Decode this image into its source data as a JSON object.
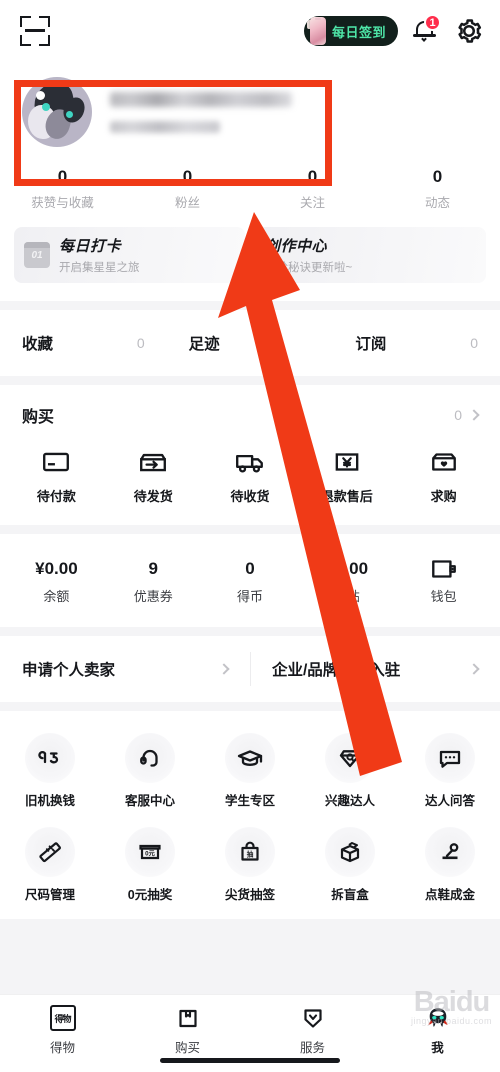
{
  "topbar": {
    "scan_icon": "scan-code-icon",
    "signin_label": "每日签到",
    "signin_bg": "#12201c",
    "signin_text_color": "#4ee6a8",
    "bell_icon": "bell-icon",
    "bell_badge": "1",
    "badge_color": "#ff2d4b",
    "gear_icon": "gear-icon"
  },
  "profile": {
    "avatar_icon": "user-avatar",
    "name_redacted": "",
    "id_redacted": "",
    "stats": [
      {
        "num": "0",
        "label": "获赞与收藏"
      },
      {
        "num": "0",
        "label": "粉丝"
      },
      {
        "num": "0",
        "label": "关注"
      },
      {
        "num": "0",
        "label": "动态"
      }
    ]
  },
  "promos": [
    {
      "title": "每日打卡",
      "subtitle": "开启集星星之旅",
      "icon": "calendar-icon",
      "icon_day": "01"
    },
    {
      "title": "创作中心",
      "subtitle": "进阶秘诀更新啦~",
      "icon": ""
    }
  ],
  "collect_row": [
    {
      "name": "收藏",
      "count": "0"
    },
    {
      "name": "足迹",
      "count": ""
    },
    {
      "name": "订阅",
      "count": "0"
    }
  ],
  "purchase": {
    "title": "购买",
    "count": "0",
    "chevron": "chevron-right-icon",
    "orders": [
      {
        "label": "待付款",
        "icon": "credit-card-icon"
      },
      {
        "label": "待发货",
        "icon": "package-shipping-icon"
      },
      {
        "label": "待收货",
        "icon": "truck-icon"
      },
      {
        "label": "退款售后",
        "icon": "refund-yen-icon"
      },
      {
        "label": "求购",
        "icon": "bag-heart-icon"
      }
    ]
  },
  "wallet": [
    {
      "value": "¥0.00",
      "label": "余额"
    },
    {
      "value": "9",
      "label": "优惠券"
    },
    {
      "value": "0",
      "label": "得币"
    },
    {
      "value": "¥0.00",
      "label": "津贴"
    },
    {
      "value": "",
      "label": "钱包",
      "icon": "wallet-icon"
    }
  ],
  "seller": [
    {
      "label": "申请个人卖家",
      "chevron": "chevron-right-icon"
    },
    {
      "label": "企业/品牌商家入驻",
      "chevron": "chevron-right-icon"
    }
  ],
  "services": [
    {
      "label": "旧机换钱",
      "icon": "phone-trade-icon"
    },
    {
      "label": "客服中心",
      "icon": "headset-icon"
    },
    {
      "label": "学生专区",
      "icon": "graduation-cap-icon"
    },
    {
      "label": "兴趣达人",
      "icon": "gem-search-icon"
    },
    {
      "label": "达人问答",
      "icon": "chat-bubble-icon"
    },
    {
      "label": "尺码管理",
      "icon": "ruler-icon"
    },
    {
      "label": "0元抽奖",
      "icon": "zero-yuan-box-icon"
    },
    {
      "label": "尖货抽签",
      "icon": "lottery-bag-icon"
    },
    {
      "label": "拆盲盒",
      "icon": "mystery-box-icon"
    },
    {
      "label": "点鞋成金",
      "icon": "shoe-gold-icon"
    }
  ],
  "bottom_nav": [
    {
      "label": "得物",
      "icon": "dewu-logo-icon",
      "logo_text": "得物",
      "active": false
    },
    {
      "label": "购买",
      "icon": "shopping-bag-icon",
      "active": false
    },
    {
      "label": "服务",
      "icon": "shield-check-icon",
      "active": false
    },
    {
      "label": "我",
      "icon": "profile-avatar-icon",
      "active": true
    }
  ],
  "annotations": {
    "rect_color": "#f03a17",
    "arrow_color": "#f03a17",
    "rect_target": "profile-name-area",
    "arrow_target": "profile-name-area"
  },
  "watermark": {
    "big": "Baidu",
    "small": "jingyan.baidu.com"
  }
}
